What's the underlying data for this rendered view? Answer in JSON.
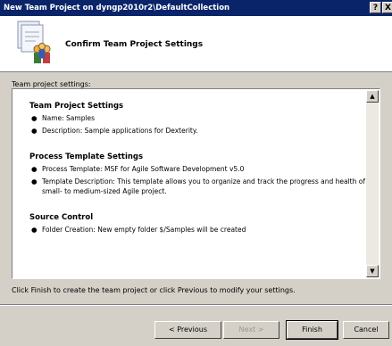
{
  "window": {
    "title": "New Team Project on dyngp2010r2\\DefaultCollection",
    "help_glyph": "?",
    "close_glyph": "X"
  },
  "header": {
    "title": "Confirm Team Project Settings",
    "icon": "team-project-wizard-icon"
  },
  "settings_label": "Team project settings:",
  "sections": [
    {
      "title": "Team Project Settings",
      "items": [
        "Name: Samples",
        "Description: Sample applications for Dexterity."
      ]
    },
    {
      "title": "Process Template Settings",
      "items": [
        "Process Template: MSF for Agile Software Development v5.0",
        "Template Description: This template allows you to organize and track the progress and health of a small- to medium-sized Agile project."
      ]
    },
    {
      "title": "Source Control",
      "items": [
        "Folder Creation: New empty folder $/Samples will be created"
      ]
    }
  ],
  "footer_text": "Click Finish to create the team project or click Previous to modify your settings.",
  "buttons": {
    "previous": "< Previous",
    "next": "Next >",
    "finish": "Finish",
    "cancel": "Cancel"
  },
  "bullet": "●"
}
